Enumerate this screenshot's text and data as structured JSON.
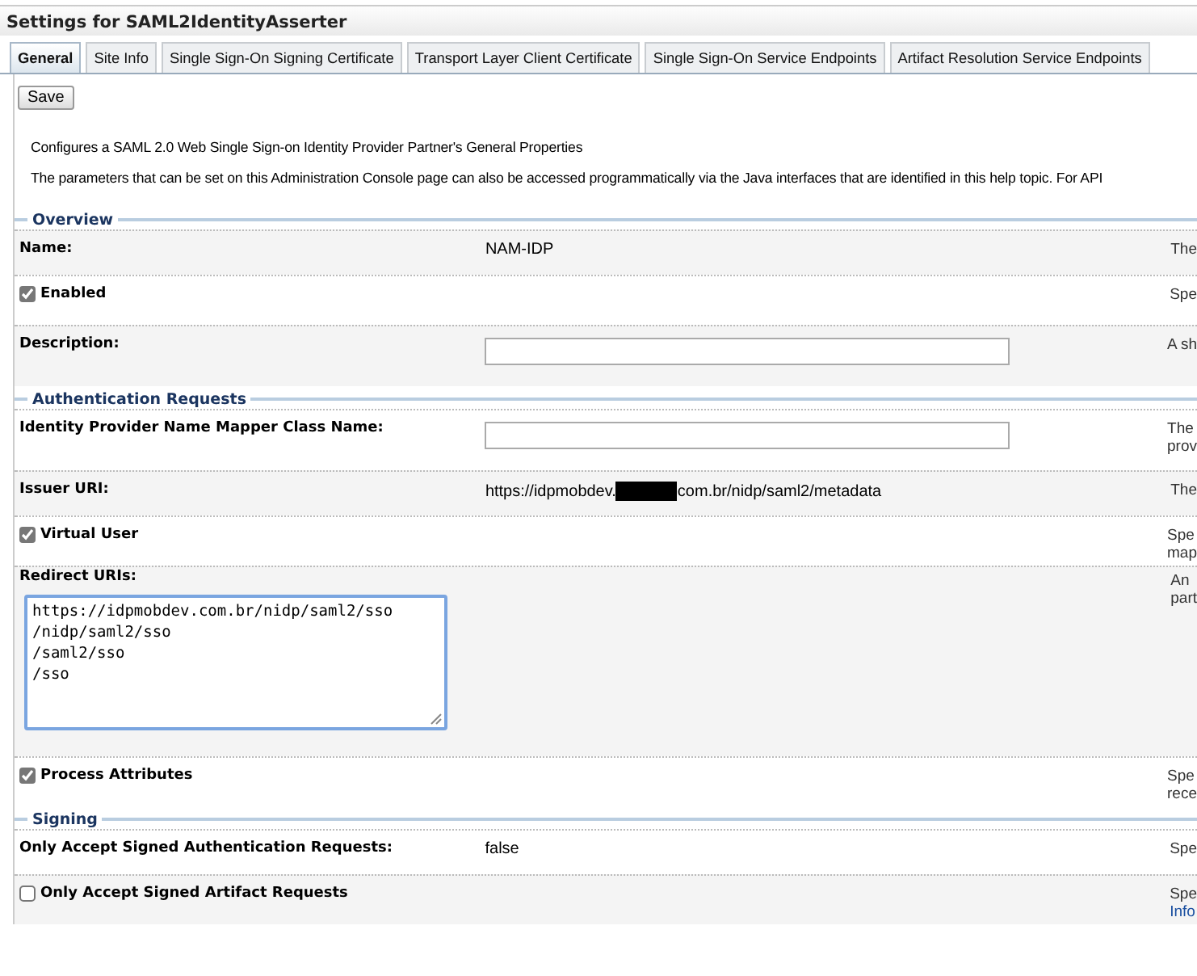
{
  "window": {
    "title": "Settings for SAML2IdentityAsserter"
  },
  "tabs": [
    {
      "label": "General",
      "selected": true
    },
    {
      "label": "Site Info",
      "selected": false
    },
    {
      "label": "Single Sign-On Signing Certificate",
      "selected": false
    },
    {
      "label": "Transport Layer Client Certificate",
      "selected": false
    },
    {
      "label": "Single Sign-On Service Endpoints",
      "selected": false
    },
    {
      "label": "Artifact Resolution Service Endpoints",
      "selected": false
    }
  ],
  "save_button": "Save",
  "intro": [
    "Configures a SAML 2.0 Web Single Sign-on Identity Provider Partner's General Properties",
    "The parameters that can be set on this Administration Console page can also be accessed programmatically via the Java interfaces that are identified in this help topic. For API"
  ],
  "sections": [
    {
      "title": "Overview",
      "rows": [
        {
          "kind": "text",
          "label": "Name:",
          "value": "NAM-IDP",
          "help": [
            "The"
          ]
        },
        {
          "kind": "checkbox",
          "label": "Enabled",
          "checked": true,
          "help": [
            "Spe"
          ]
        },
        {
          "kind": "input",
          "label": "Description:",
          "value": "",
          "help": [
            "A sh"
          ]
        }
      ]
    },
    {
      "title": "Authentication Requests",
      "rows": [
        {
          "kind": "input",
          "label": "Identity Provider Name Mapper Class Name:",
          "value": "",
          "help": [
            "The",
            "prov"
          ]
        },
        {
          "kind": "redacted",
          "label": "Issuer URI:",
          "value_before": "https://idpmobdev.",
          "value_after": "com.br/nidp/saml2/metadata",
          "help": [
            "The"
          ]
        },
        {
          "kind": "checkbox",
          "label": "Virtual User",
          "checked": true,
          "help": [
            "Spe",
            "map"
          ]
        },
        {
          "kind": "textarea",
          "label": "Redirect URIs:",
          "lines": [
            "https://idpmobdev.com.br/nidp/saml2/sso",
            "/nidp/saml2/sso",
            "/saml2/sso",
            "/sso"
          ],
          "help": [
            "An",
            "part"
          ]
        },
        {
          "kind": "checkbox",
          "label": "Process Attributes",
          "checked": true,
          "help": [
            "Spe",
            "rece"
          ]
        }
      ]
    },
    {
      "title": "Signing",
      "rows": [
        {
          "kind": "text",
          "label": "Only Accept Signed Authentication Requests:",
          "value": "false",
          "help": [
            "Spe"
          ]
        },
        {
          "kind": "checkbox",
          "label": "Only Accept Signed Artifact Requests",
          "checked": false,
          "help": [
            "Spe"
          ],
          "help_link": "Info"
        }
      ]
    }
  ]
}
